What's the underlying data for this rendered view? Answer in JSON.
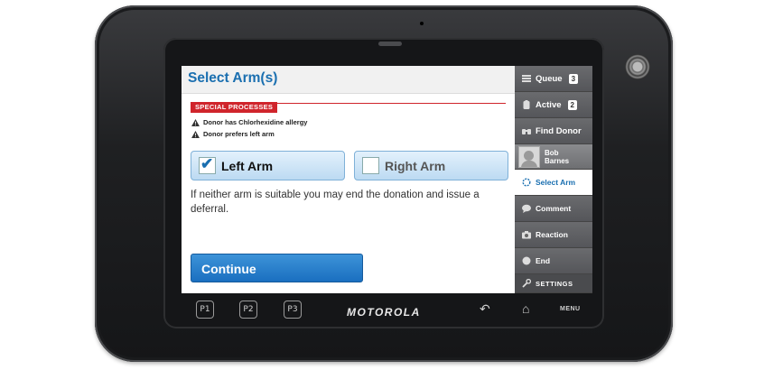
{
  "screen": {
    "title": "Select Arm(s)",
    "special_processes": {
      "badge": "SPECIAL PROCESSES",
      "warnings": [
        "Donor has Chlorhexidine allergy",
        "Donor prefers left arm"
      ]
    },
    "arms": {
      "left": {
        "label": "Left Arm",
        "checked": true
      },
      "right": {
        "label": "Right Arm",
        "checked": false
      }
    },
    "info_text": "If neither arm is suitable you may end the donation and issue a deferral.",
    "continue_label": "Continue"
  },
  "sidebar": {
    "queue": {
      "label": "Queue",
      "count": "3"
    },
    "active": {
      "label": "Active",
      "count": "2"
    },
    "find_donor": {
      "label": "Find Donor"
    },
    "profile": {
      "first": "Bob",
      "last": "Barnes"
    },
    "select_arm": {
      "label": "Select Arm"
    },
    "comment": {
      "label": "Comment"
    },
    "reaction": {
      "label": "Reaction"
    },
    "end": {
      "label": "End"
    },
    "settings": {
      "label": "SETTINGS"
    }
  },
  "device": {
    "brand": "MOTOROLA",
    "buttons": [
      "P1",
      "P2",
      "P3"
    ],
    "menu_label": "MENU"
  },
  "colors": {
    "accent": "#1a6fb0",
    "warning": "#d0242b",
    "sidebar": "#5a5b5e"
  }
}
